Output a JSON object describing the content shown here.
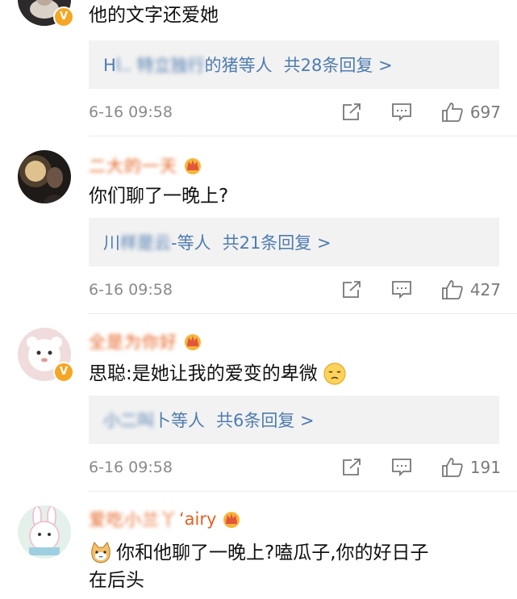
{
  "comments": [
    {
      "username": "",
      "verified": true,
      "text": "他的文字还爱她",
      "reply_names_visible_start": "H",
      "reply_names_blurred": "l.. 特立独行",
      "reply_names_visible_end": "的猪等人",
      "reply_count_text": "共28条回复 >",
      "time": "6-16 09:58",
      "likes": "697"
    },
    {
      "username": "二大的一天",
      "verified": false,
      "text": "你们聊了一晚上?",
      "reply_names_visible_start": "川",
      "reply_names_blurred": "样是云",
      "reply_names_visible_end": "-等人",
      "reply_count_text": "共21条回复 >",
      "time": "6-16 09:58",
      "likes": "427"
    },
    {
      "username": "全是为你好",
      "verified": true,
      "text_prefix": "思聪: ",
      "text": "是她让我的爱变的卑微",
      "reply_names_visible_start": "",
      "reply_names_blurred": "小二叫",
      "reply_names_visible_end": "卜等人",
      "reply_count_text": "共6条回复 >",
      "time": "6-16 09:58",
      "likes": "191"
    },
    {
      "username": "爱吃小兰丫",
      "username_tail": "ʻairy",
      "verified": false,
      "text_line1": "你和他聊了一晚上?嗑瓜子,你的好日子",
      "text_line2": "在后头"
    }
  ],
  "icons": {
    "share": "share-icon",
    "comment": "comment-icon",
    "like": "thumbs-up-icon",
    "badge": "crown-badge-icon",
    "verified": "verified-v-icon"
  },
  "colors": {
    "link": "#4e7cb0",
    "username": "#e4611f",
    "meta": "#8a8a8a",
    "reply_bg": "#f2f2f2",
    "verified_badge": "#f5a623"
  }
}
